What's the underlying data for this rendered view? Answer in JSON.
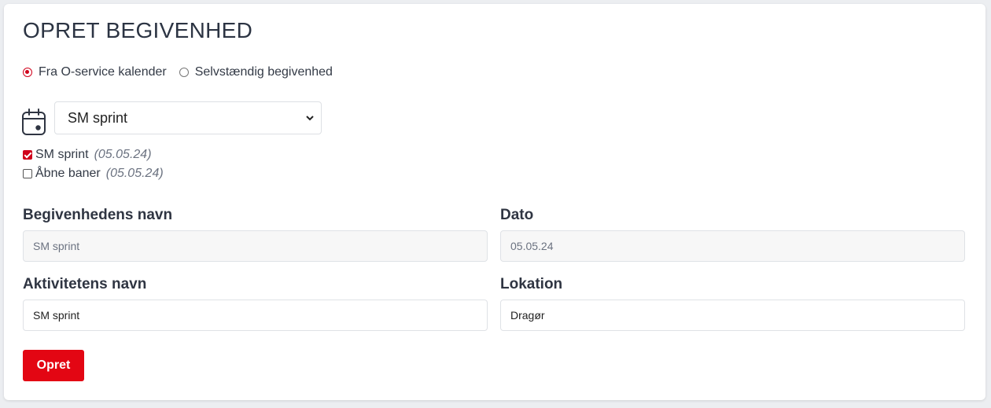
{
  "page": {
    "title": "OPRET BEGIVENHED",
    "accent_color": "#e30613"
  },
  "source": {
    "options": [
      {
        "label": "Fra O-service kalender",
        "selected": true
      },
      {
        "label": "Selvstændig begivenhed",
        "selected": false
      }
    ]
  },
  "calendar": {
    "icon": "calendar-icon",
    "selected_event": "SM sprint"
  },
  "activities": [
    {
      "name": "SM sprint",
      "date": "(05.05.24)",
      "checked": true
    },
    {
      "name": "Åbne baner",
      "date": "(05.05.24)",
      "checked": false
    }
  ],
  "form": {
    "event_name_label": "Begivenhedens navn",
    "event_name_value": "SM sprint",
    "date_label": "Dato",
    "date_value": "05.05.24",
    "activity_name_label": "Aktivitetens navn",
    "activity_name_value": "SM sprint",
    "location_label": "Lokation",
    "location_value": "Dragør"
  },
  "submit": {
    "label": "Opret"
  }
}
